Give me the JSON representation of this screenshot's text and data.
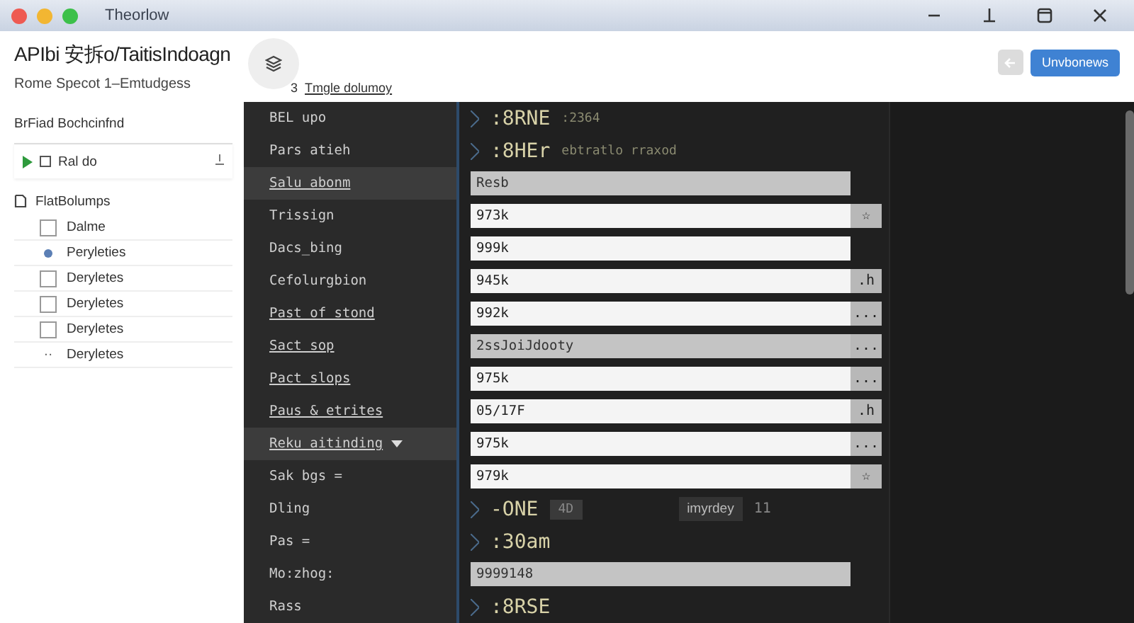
{
  "window": {
    "title": "Theorlow"
  },
  "header": {
    "title": "APIbi 安拆o/TaitisIndoagn",
    "subtitle": "Rome  Specot 1–Emtudgess",
    "link_count": "3",
    "link": "Tmgle dolumoy",
    "buttons": [
      {
        "kind": "back"
      },
      {
        "kind": "primary",
        "label": "Unvbonews"
      }
    ]
  },
  "sidebar": {
    "heading": "BrFiad Bochcinfnd",
    "field": {
      "value": "Ral do"
    },
    "tree": {
      "label": "FlatBolumps",
      "expanded": true,
      "children": [
        {
          "label": "Dalme",
          "kind": "checkbox",
          "checked": false
        },
        {
          "label": "Peryleties",
          "kind": "bullet"
        },
        {
          "label": "Deryletes",
          "kind": "checkbox",
          "checked": false
        },
        {
          "label": "Deryletes",
          "kind": "checkbox",
          "checked": false
        },
        {
          "label": "Deryletes",
          "kind": "checkbox",
          "checked": false
        },
        {
          "label": "Deryletes",
          "kind": "ellipsis",
          "marker": "··"
        }
      ]
    }
  },
  "rows": [
    {
      "label": "BEL upo",
      "link": false,
      "highlighted": false,
      "kind": "code",
      "value": ":8RNE",
      "extra": ":2364"
    },
    {
      "label": "Pars atieh",
      "link": false,
      "highlighted": false,
      "kind": "code",
      "value": ":8HEr",
      "extra": "ebtratlo  rraxod"
    },
    {
      "label": "Salu abonm",
      "link": true,
      "highlighted": true,
      "kind": "field",
      "value": "Resb",
      "disabled": true
    },
    {
      "label": "Trissign",
      "link": false,
      "highlighted": false,
      "kind": "field",
      "value": "973k",
      "suffix": "☆",
      "disabled": false
    },
    {
      "label": "Dacs_bing",
      "link": false,
      "highlighted": false,
      "kind": "field",
      "value": "999k",
      "disabled": false
    },
    {
      "label": "Cefolurgbion",
      "link": false,
      "highlighted": false,
      "kind": "field",
      "value": "945k",
      "suffix": ".h",
      "disabled": false
    },
    {
      "label": "Past of stond",
      "link": true,
      "highlighted": false,
      "kind": "field",
      "value": "992k",
      "suffix": "...",
      "disabled": false
    },
    {
      "label": "Sact sop",
      "link": true,
      "highlighted": false,
      "kind": "field",
      "value": "2ssJoiJdooty",
      "suffix": "...",
      "disabled": true
    },
    {
      "label": "Pact slops",
      "link": true,
      "highlighted": false,
      "kind": "field",
      "value": "975k",
      "suffix": "...",
      "disabled": false
    },
    {
      "label": "Paus & etrites",
      "link": true,
      "highlighted": false,
      "kind": "field",
      "value": "05/17F",
      "suffix": ".h",
      "disabled": false
    },
    {
      "label": "Reku aitinding",
      "link": true,
      "highlighted": true,
      "dropdown": true,
      "kind": "field",
      "value": "975k",
      "suffix": "...",
      "disabled": false
    },
    {
      "label": "Sak bgs =",
      "link": false,
      "highlighted": false,
      "kind": "field",
      "value": "979k",
      "suffix": "☆",
      "disabled": false
    },
    {
      "label": "Dling",
      "link": false,
      "highlighted": false,
      "kind": "code",
      "value": "-ONE",
      "tag": "4D",
      "note": "imyrdey",
      "count": "11"
    },
    {
      "label": "Pas =",
      "link": false,
      "highlighted": false,
      "kind": "code",
      "value": ":30am"
    },
    {
      "label": "Mo:zhog:",
      "link": false,
      "highlighted": false,
      "kind": "field",
      "value": "9999148",
      "disabled": true
    },
    {
      "label": "Rass",
      "link": false,
      "highlighted": false,
      "kind": "code",
      "value": ":8RSE"
    }
  ]
}
